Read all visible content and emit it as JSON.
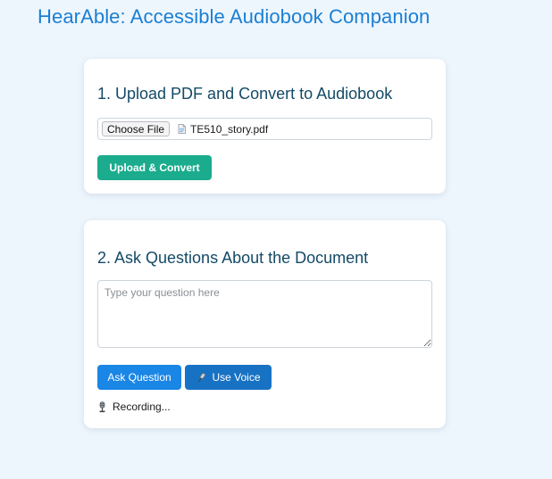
{
  "app": {
    "title": "HearAble: Accessible Audiobook Companion"
  },
  "upload": {
    "title": "1. Upload PDF and Convert to Audiobook",
    "choose_file_label": "Choose File",
    "file_name": "TE510_story.pdf",
    "file_icon": "document-icon",
    "submit_label": "Upload & Convert"
  },
  "ask": {
    "title": "2. Ask Questions About the Document",
    "question_placeholder": "Type your question here",
    "question_value": "",
    "ask_label": "Ask Question",
    "voice_label": "Use Voice",
    "voice_icon": "microphone-icon",
    "status_icon": "studio-microphone-icon",
    "status_text": "Recording..."
  },
  "colors": {
    "background": "#eef6fd",
    "title": "#1a7fd4",
    "heading": "#134a66",
    "upload_button": "#1aac8d",
    "ask_button": "#1a86e6",
    "voice_button": "#1872c4"
  }
}
